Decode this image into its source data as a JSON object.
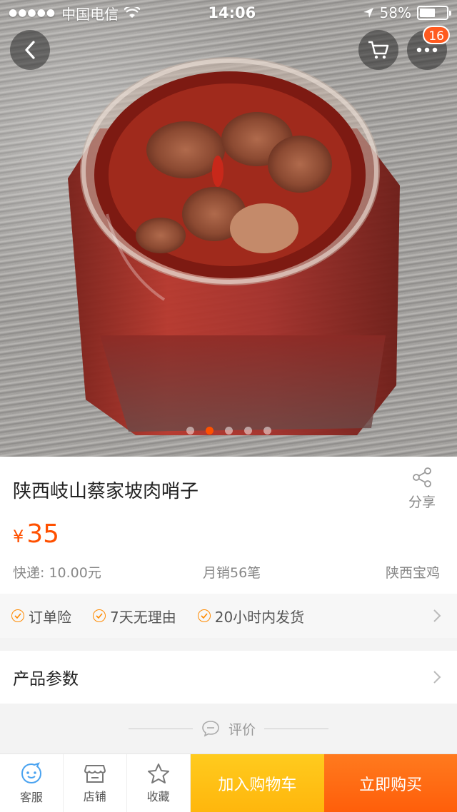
{
  "status_bar": {
    "carrier": "中国电信",
    "time": "14:06",
    "battery": "58%",
    "battery_level": 0.58
  },
  "header": {
    "cart_badge": "16"
  },
  "gallery": {
    "image_count": 5,
    "active_index": 1
  },
  "product": {
    "title": "陕西岐山蔡家坡肉哨子",
    "share_label": "分享",
    "currency": "¥",
    "price": "35",
    "shipping": "快递: 10.00元",
    "monthly_sales": "月销56笔",
    "location": "陕西宝鸡"
  },
  "guarantees": [
    {
      "label": "订单险"
    },
    {
      "label": "7天无理由"
    },
    {
      "label": "20小时内发货"
    }
  ],
  "params_label": "产品参数",
  "review_label": "评价",
  "bottom_bar": {
    "service": "客服",
    "shop": "店铺",
    "favorite": "收藏",
    "add_to_cart": "加入购物车",
    "buy_now": "立即购买"
  },
  "colors": {
    "accent": "#ff5000",
    "add_to_cart_bg": "#ffb60c",
    "buy_now_bg": "#ff5e0a"
  }
}
